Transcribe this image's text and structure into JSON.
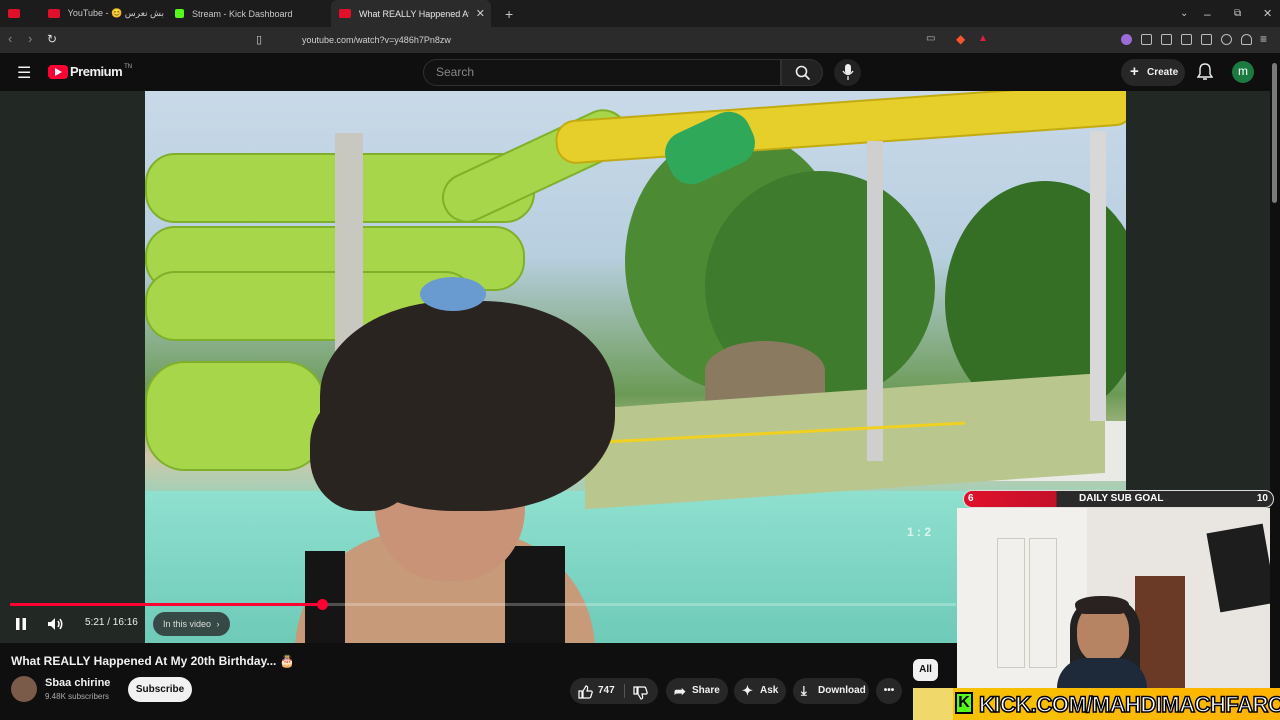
{
  "browser": {
    "tabs": [
      {
        "label": "YouTube - ‫أخيرا بش نعرس 😊‬",
        "icon": "youtube-icon"
      },
      {
        "label": "Stream - Kick Dashboard",
        "icon": "kick-icon"
      },
      {
        "label": "What REALLY Happened At M",
        "icon": "youtube-icon",
        "active": true
      }
    ],
    "url": "youtube.com/watch?v=y486h7Pn8zw"
  },
  "yt": {
    "logo": "Premium",
    "logo_sup": "TN",
    "search_placeholder": "Search",
    "create_label": "Create",
    "avatar_letter": "m"
  },
  "player": {
    "current_time": "5:21 / 16:16",
    "in_this_video": "In this video",
    "progress": 0.33,
    "watermark": "1 : 2"
  },
  "overlay": {
    "goal_label": "DAILY SUB GOAL",
    "goal_current": "6",
    "goal_target": "10",
    "kick_text": "KICK.COM/MAHDIMACHFAROTB"
  },
  "video": {
    "title": "What REALLY Happened At My 20th Birthday... 🎂",
    "channel": "Sbaa chirine",
    "subscribers": "9.48K subscribers",
    "subscribe_label": "Subscribe",
    "likes": "747",
    "share_label": "Share",
    "ask_label": "Ask",
    "download_label": "Download",
    "chip_all": "All"
  },
  "colors": {
    "accent": "#ff0033",
    "kick": "#53fc18",
    "avatar": "#1b7a3f"
  }
}
